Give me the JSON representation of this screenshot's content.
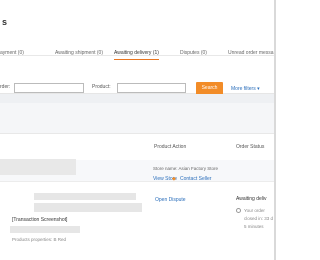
{
  "header": {
    "title": "s"
  },
  "tabs": [
    {
      "label": "ayment (0)"
    },
    {
      "label": "Awaiting shipment (0)"
    },
    {
      "label": "Awaiting delivery (1)"
    },
    {
      "label": "Disputes (0)"
    },
    {
      "label": "Unread order messa"
    }
  ],
  "filters": {
    "order_label": "rder:",
    "product_label": "Product:",
    "search_label": "Search",
    "more_label": "More filters ▾"
  },
  "table": {
    "col_action": "Product Action",
    "col_status": "Order Status"
  },
  "store": {
    "name_label": "Store name: Asian Factory Store",
    "view_store": "View Store",
    "contact_seller": "Contact Seller"
  },
  "order": {
    "product_tag": "[Transaction Screenshot]",
    "properties": "Products properties: B Red",
    "open_dispute": "Open Dispute",
    "status": "Awaiting deliv",
    "timer_lines": [
      "Your order",
      "closed in: 33 d",
      "5 minutes"
    ]
  },
  "colors": {
    "accent": "#f28c28",
    "link": "#2a6ebb"
  }
}
